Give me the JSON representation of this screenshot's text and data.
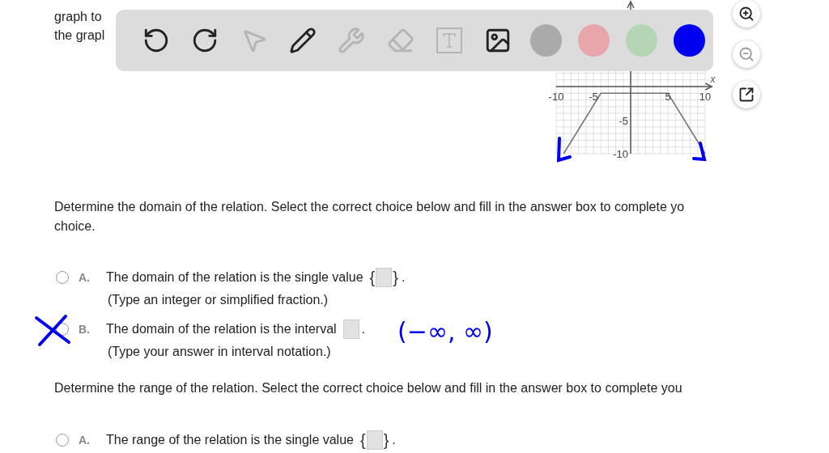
{
  "question": {
    "lines": [
      "graph to",
      "the grapl"
    ]
  },
  "toolbar": {
    "tools": [
      {
        "kind": "undo",
        "disabled": false
      },
      {
        "kind": "redo",
        "disabled": false
      },
      {
        "kind": "pointer",
        "disabled": true
      },
      {
        "kind": "pen",
        "disabled": false
      },
      {
        "kind": "tools",
        "disabled": true
      },
      {
        "kind": "eraser",
        "disabled": true
      },
      {
        "kind": "text",
        "disabled": true
      },
      {
        "kind": "image",
        "disabled": false
      }
    ],
    "colors": [
      {
        "color": "#aaaaaa"
      },
      {
        "color": "#e8a5ab"
      },
      {
        "color": "#b5d6b4"
      },
      {
        "color": "#0000ee"
      }
    ]
  },
  "graph": {
    "axis_label": "x",
    "chart_data": {
      "type": "line",
      "x": [
        -9,
        -4,
        5,
        10
      ],
      "grid": true,
      "series": [
        {
          "color": "#777777",
          "values": [
            -10,
            -1,
            -1,
            -10
          ]
        }
      ],
      "xlim": [
        -10,
        10
      ],
      "ylim": [
        -10,
        10
      ],
      "xticks": [
        -10,
        -5,
        5,
        10
      ],
      "yticks": [
        -10,
        -5
      ]
    }
  },
  "side_buttons": [
    {
      "kind": "zoom-in",
      "disabled": false
    },
    {
      "kind": "zoom-out",
      "disabled": true
    },
    {
      "kind": "pop-out",
      "disabled": false
    }
  ],
  "parts": [
    {
      "prompt": [
        "Determine the domain of the relation. Select the correct choice below and fill in the answer box to complete yo",
        "choice."
      ],
      "options": [
        {
          "letter": "A.",
          "selected": false,
          "crossed": false,
          "prefix": "The domain of the relation is the single value",
          "open": "{",
          "close": "}",
          "suffix": ".",
          "hint": "(Type an integer or simplified fraction.)"
        },
        {
          "letter": "B.",
          "selected": false,
          "crossed": true,
          "prefix": "The domain of the relation is the interval",
          "suffix": ".",
          "annotation": "(−∞, ∞)",
          "hint": "(Type your answer in interval notation.)"
        }
      ]
    },
    {
      "prompt": [
        "Determine the range of the relation. Select the correct choice below and fill in the answer box to complete you"
      ],
      "options": [
        {
          "letter": "A.",
          "selected": false,
          "crossed": false,
          "prefix": "The range of the relation is the single value",
          "open": "{",
          "close": "}",
          "suffix": "."
        }
      ]
    }
  ]
}
